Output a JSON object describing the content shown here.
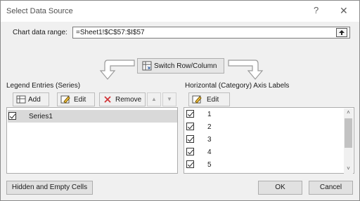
{
  "dialog": {
    "title": "Select Data Source"
  },
  "titlebar": {
    "help": "?",
    "close": "✕"
  },
  "chart_range": {
    "label": "Chart data range:",
    "value": "=Sheet1!$C$57:$I$57"
  },
  "switch_button": {
    "label": "Switch Row/Column"
  },
  "legend": {
    "heading": "Legend Entries (Series)",
    "add_label": "Add",
    "edit_label": "Edit",
    "remove_label": "Remove",
    "up_label": "▲",
    "down_label": "▼",
    "items": [
      {
        "label": "Series1",
        "checked": true
      }
    ]
  },
  "axis": {
    "heading": "Horizontal (Category) Axis Labels",
    "edit_label": "Edit",
    "items": [
      {
        "label": "1",
        "checked": true
      },
      {
        "label": "2",
        "checked": true
      },
      {
        "label": "3",
        "checked": true
      },
      {
        "label": "4",
        "checked": true
      },
      {
        "label": "5",
        "checked": true
      }
    ]
  },
  "footer": {
    "hidden_cells_label": "Hidden and Empty Cells",
    "ok_label": "OK",
    "cancel_label": "Cancel"
  }
}
